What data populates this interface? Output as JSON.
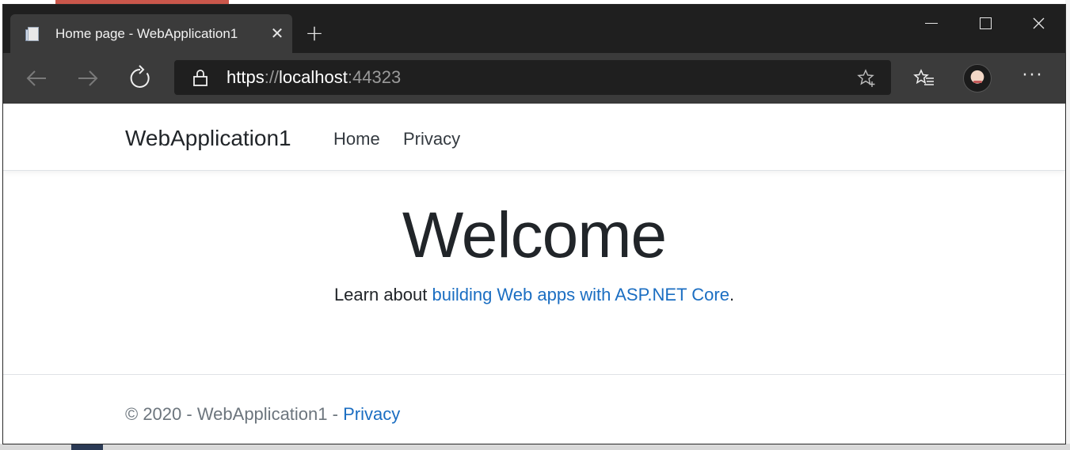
{
  "browser": {
    "tab": {
      "title": "Home page - WebApplication1",
      "favicon_icon": "page-icon",
      "close_icon": "close-icon"
    },
    "new_tab_icon": "plus-icon",
    "window_controls": {
      "minimize_icon": "minimize-icon",
      "maximize_icon": "maximize-icon",
      "close_icon": "close-icon"
    },
    "toolbar": {
      "back_icon": "arrow-left-icon",
      "forward_icon": "arrow-right-icon",
      "refresh_icon": "refresh-icon",
      "favorites_icon": "favorites-list-icon",
      "more_label": "···"
    },
    "address": {
      "lock_icon": "lock-icon",
      "scheme": "https",
      "separator": "://",
      "host": "localhost",
      "port": ":44323",
      "favorite_icon": "star-add-icon"
    },
    "colors": {
      "titlebar": "#1f1f1f",
      "toolbar": "#3b3b3b",
      "link": "#1b6ec2"
    }
  },
  "site": {
    "brand": "WebApplication1",
    "nav": {
      "home": "Home",
      "privacy": "Privacy"
    },
    "hero": {
      "title": "Welcome",
      "text_before": "Learn about ",
      "link_text": "building Web apps with ASP.NET Core",
      "text_after": "."
    },
    "footer": {
      "text": "© 2020 - WebApplication1 - ",
      "link_text": "Privacy"
    }
  }
}
